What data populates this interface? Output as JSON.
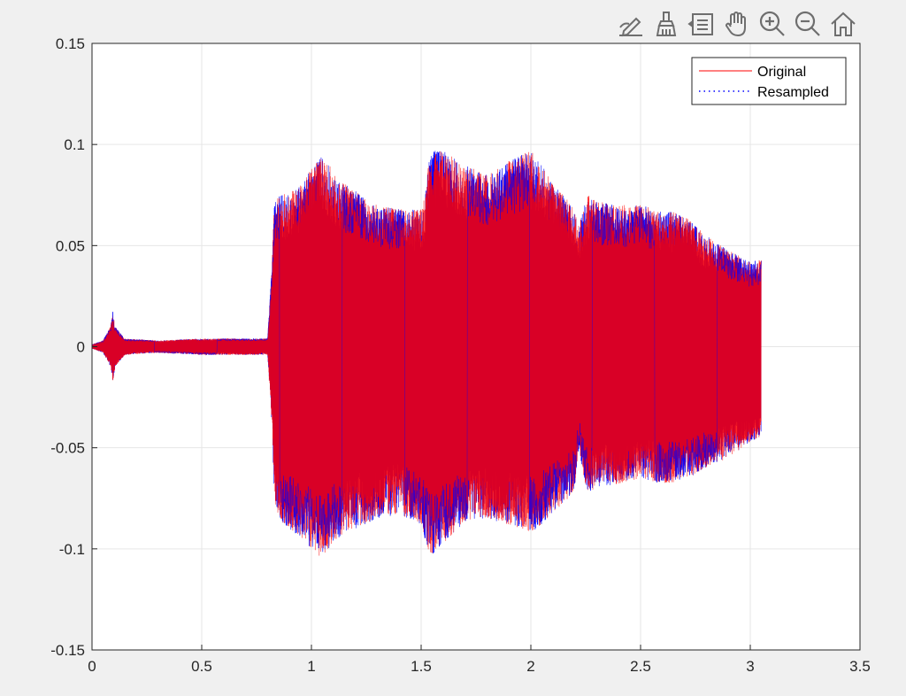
{
  "window": {
    "background": "#f0f0f0"
  },
  "toolbar": {
    "buttons": [
      {
        "name": "edit-plot-icon"
      },
      {
        "name": "brush-icon"
      },
      {
        "name": "data-tips-icon"
      },
      {
        "name": "pan-hand-icon"
      },
      {
        "name": "zoom-in-icon"
      },
      {
        "name": "zoom-out-icon"
      },
      {
        "name": "home-icon"
      }
    ],
    "icon_color": "#6e6e6e"
  },
  "chart_data": {
    "type": "line",
    "title": "",
    "xlabel": "",
    "ylabel": "",
    "xlim": [
      0,
      3.5
    ],
    "ylim": [
      -0.15,
      0.15
    ],
    "xticks": [
      "0",
      "0.5",
      "1",
      "1.5",
      "2",
      "2.5",
      "3",
      "3.5"
    ],
    "xtick_values": [
      0,
      0.5,
      1,
      1.5,
      2,
      2.5,
      3,
      3.5
    ],
    "yticks": [
      "0.15",
      "0.1",
      "0.05",
      "0",
      "-0.05",
      "-0.1",
      "-0.15"
    ],
    "ytick_values": [
      0.15,
      0.1,
      0.05,
      0,
      -0.05,
      -0.1,
      -0.15
    ],
    "grid": true,
    "legend_position": "top-right",
    "series": [
      {
        "name": "Original",
        "color": "#ff0000",
        "style": "solid"
      },
      {
        "name": "Resampled",
        "color": "#0000ff",
        "style": "dotted"
      }
    ],
    "envelope": {
      "t": [
        0,
        0.05,
        0.085,
        0.095,
        0.105,
        0.12,
        0.15,
        0.3,
        0.5,
        0.7,
        0.8,
        0.82,
        0.83,
        0.85,
        0.9,
        0.95,
        1.0,
        1.04,
        1.08,
        1.12,
        1.2,
        1.3,
        1.4,
        1.5,
        1.52,
        1.54,
        1.56,
        1.6,
        1.65,
        1.7,
        1.8,
        1.9,
        2.0,
        2.05,
        2.1,
        2.15,
        2.2,
        2.22,
        2.24,
        2.26,
        2.3,
        2.4,
        2.5,
        2.6,
        2.7,
        2.8,
        2.9,
        3.0,
        3.05
      ],
      "upper": [
        0.001,
        0.003,
        0.01,
        0.018,
        0.01,
        0.008,
        0.004,
        0.003,
        0.004,
        0.004,
        0.004,
        0.04,
        0.07,
        0.075,
        0.076,
        0.08,
        0.088,
        0.094,
        0.09,
        0.083,
        0.077,
        0.07,
        0.068,
        0.068,
        0.077,
        0.096,
        0.097,
        0.097,
        0.094,
        0.09,
        0.085,
        0.092,
        0.097,
        0.09,
        0.08,
        0.075,
        0.068,
        0.06,
        0.068,
        0.075,
        0.072,
        0.07,
        0.07,
        0.068,
        0.065,
        0.055,
        0.048,
        0.042,
        0.043
      ],
      "lower": [
        -0.001,
        -0.003,
        -0.01,
        -0.018,
        -0.01,
        -0.008,
        -0.004,
        -0.003,
        -0.004,
        -0.004,
        -0.004,
        -0.04,
        -0.075,
        -0.085,
        -0.09,
        -0.095,
        -0.1,
        -0.104,
        -0.1,
        -0.095,
        -0.09,
        -0.085,
        -0.083,
        -0.088,
        -0.097,
        -0.104,
        -0.103,
        -0.098,
        -0.092,
        -0.087,
        -0.085,
        -0.088,
        -0.092,
        -0.088,
        -0.082,
        -0.078,
        -0.07,
        -0.05,
        -0.065,
        -0.072,
        -0.07,
        -0.068,
        -0.065,
        -0.068,
        -0.066,
        -0.06,
        -0.055,
        -0.047,
        -0.045
      ]
    }
  }
}
